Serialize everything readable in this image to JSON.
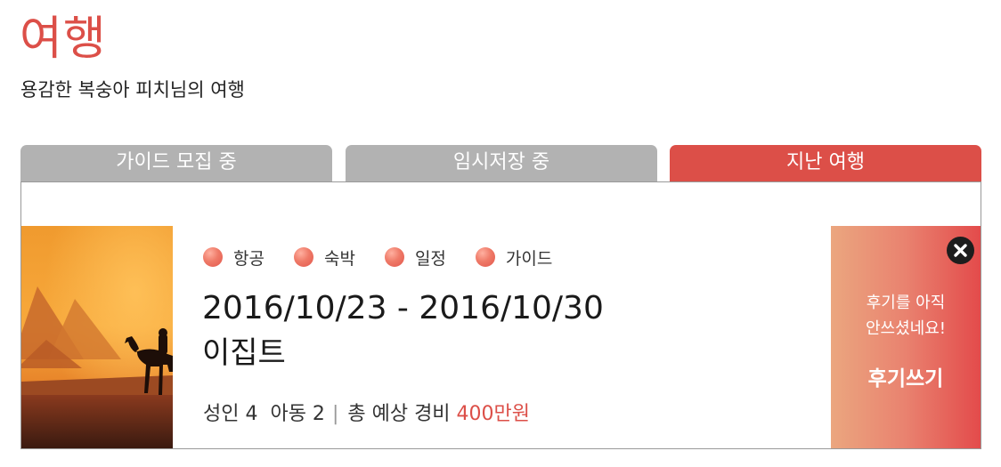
{
  "page": {
    "title": "여행",
    "subtitle": "용감한 복숭아 피치님의 여행"
  },
  "tabs": [
    {
      "label": "가이드 모집 중",
      "active": false
    },
    {
      "label": "임시저장 중",
      "active": false
    },
    {
      "label": "지난 여행",
      "active": true
    }
  ],
  "trip": {
    "photo_icon": "egypt-pyramids-camel-photo",
    "badges": [
      {
        "label": "항공"
      },
      {
        "label": "숙박"
      },
      {
        "label": "일정"
      },
      {
        "label": "가이드"
      }
    ],
    "dates": "2016/10/23 - 2016/10/30",
    "destination": "이집트",
    "travelers": "성인 4  아동 2",
    "separator": "|",
    "cost_label": "총 예상 경비",
    "cost_value": "400만원"
  },
  "review": {
    "close_icon": "close-icon",
    "message_line1": "후기를 아직",
    "message_line2": "안쓰셨네요!",
    "button_label": "후기쓰기"
  },
  "colors": {
    "accent": "#dc4f48",
    "tab_inactive": "#b2b2b2",
    "gradient_start": "#eba67f",
    "gradient_end": "#e34b4b"
  }
}
